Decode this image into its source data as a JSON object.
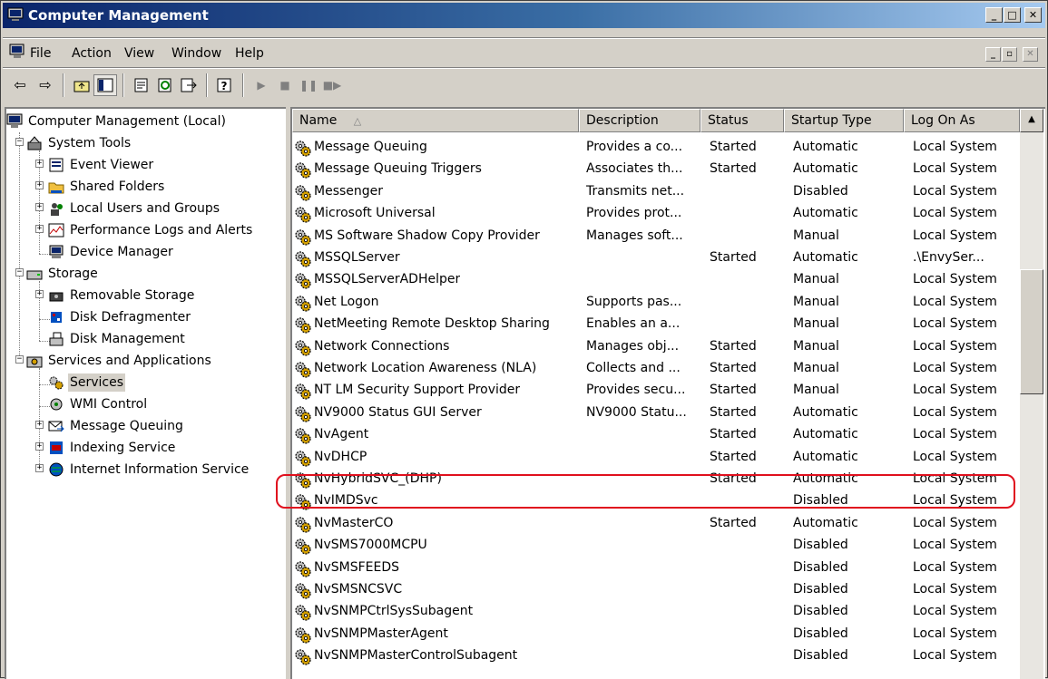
{
  "window": {
    "title": "Computer Management"
  },
  "menu": [
    "File",
    "Action",
    "View",
    "Window",
    "Help"
  ],
  "toolbar": [
    "back-arrow-icon",
    "forward-arrow-icon",
    "up-folder-icon",
    "show-hide-tree-icon",
    "properties-icon",
    "refresh-icon",
    "export-list-icon",
    "help-icon",
    "play-icon",
    "stop-icon",
    "pause-icon",
    "restart-icon"
  ],
  "tree": {
    "root": "Computer Management (Local)",
    "system_tools": "System Tools",
    "event_viewer": "Event Viewer",
    "shared_folders": "Shared Folders",
    "local_users": "Local Users and Groups",
    "perf_logs": "Performance Logs and Alerts",
    "device_manager": "Device Manager",
    "storage": "Storage",
    "removable_storage": "Removable Storage",
    "disk_defrag": "Disk Defragmenter",
    "disk_mgmt": "Disk Management",
    "services_apps": "Services and Applications",
    "services": "Services",
    "wmi": "WMI Control",
    "msg_queuing": "Message Queuing",
    "indexing": "Indexing Service",
    "iis": "Internet Information Service"
  },
  "columns": {
    "name": "Name",
    "sort_indicator": "△",
    "description": "Description",
    "status": "Status",
    "startup": "Startup Type",
    "logon": "Log On As"
  },
  "rows": [
    {
      "name": "Message Queuing",
      "description": "Provides a co...",
      "status": "Started",
      "startup": "Automatic",
      "logon": "Local System"
    },
    {
      "name": "Message Queuing Triggers",
      "description": "Associates th...",
      "status": "Started",
      "startup": "Automatic",
      "logon": "Local System"
    },
    {
      "name": "Messenger",
      "description": "Transmits net...",
      "status": "",
      "startup": "Disabled",
      "logon": "Local System"
    },
    {
      "name": "Microsoft Universal",
      "description": "Provides prot...",
      "status": "",
      "startup": "Automatic",
      "logon": "Local System"
    },
    {
      "name": "MS Software Shadow Copy Provider",
      "description": "Manages soft...",
      "status": "",
      "startup": "Manual",
      "logon": "Local System"
    },
    {
      "name": "MSSQLServer",
      "description": "",
      "status": "Started",
      "startup": "Automatic",
      "logon": ".\\EnvySer..."
    },
    {
      "name": "MSSQLServerADHelper",
      "description": "",
      "status": "",
      "startup": "Manual",
      "logon": "Local System"
    },
    {
      "name": "Net Logon",
      "description": "Supports pas...",
      "status": "",
      "startup": "Manual",
      "logon": "Local System"
    },
    {
      "name": "NetMeeting Remote Desktop Sharing",
      "description": "Enables an a...",
      "status": "",
      "startup": "Manual",
      "logon": "Local System"
    },
    {
      "name": "Network Connections",
      "description": "Manages obj...",
      "status": "Started",
      "startup": "Manual",
      "logon": "Local System"
    },
    {
      "name": "Network Location Awareness (NLA)",
      "description": "Collects and ...",
      "status": "Started",
      "startup": "Manual",
      "logon": "Local System"
    },
    {
      "name": "NT LM Security Support Provider",
      "description": "Provides secu...",
      "status": "Started",
      "startup": "Manual",
      "logon": "Local System"
    },
    {
      "name": "NV9000 Status GUI Server",
      "description": "NV9000 Statu...",
      "status": "Started",
      "startup": "Automatic",
      "logon": "Local System"
    },
    {
      "name": "NvAgent",
      "description": "",
      "status": "Started",
      "startup": "Automatic",
      "logon": "Local System"
    },
    {
      "name": "NvDHCP",
      "description": "",
      "status": "Started",
      "startup": "Automatic",
      "logon": "Local System"
    },
    {
      "name": "NvHybridSVC_(DHP)",
      "description": "",
      "status": "Started",
      "startup": "Automatic",
      "logon": "Local System"
    },
    {
      "name": "NvIMDSvc",
      "description": "",
      "status": "",
      "startup": "Disabled",
      "logon": "Local System"
    },
    {
      "name": "NvMasterCO",
      "description": "",
      "status": "Started",
      "startup": "Automatic",
      "logon": "Local System"
    },
    {
      "name": "NvSMS7000MCPU",
      "description": "",
      "status": "",
      "startup": "Disabled",
      "logon": "Local System"
    },
    {
      "name": "NvSMSFEEDS",
      "description": "",
      "status": "",
      "startup": "Disabled",
      "logon": "Local System"
    },
    {
      "name": "NvSMSNCSVC",
      "description": "",
      "status": "",
      "startup": "Disabled",
      "logon": "Local System"
    },
    {
      "name": "NvSNMPCtrlSysSubagent",
      "description": "",
      "status": "",
      "startup": "Disabled",
      "logon": "Local System"
    },
    {
      "name": "NvSNMPMasterAgent",
      "description": "",
      "status": "",
      "startup": "Disabled",
      "logon": "Local System"
    },
    {
      "name": "NvSNMPMasterControlSubagent",
      "description": "",
      "status": "",
      "startup": "Disabled",
      "logon": "Local System"
    }
  ],
  "highlighted_row": "NvHybridSVC_(DHP)",
  "colors": {
    "title_gradient_start": "#0a246a",
    "title_gradient_end": "#a6caf0",
    "highlight_outline": "#e0101e",
    "selection_bg": "#d4d0c8"
  }
}
